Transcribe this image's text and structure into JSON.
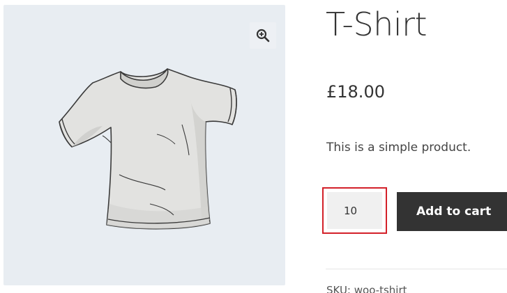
{
  "product": {
    "title": "T-Shirt",
    "price": "£18.00",
    "description": "This is a simple product.",
    "sku_label": "SKU:",
    "sku_value": "woo-tshirt"
  },
  "purchase": {
    "quantity": "10",
    "add_to_cart_label": "Add to cart"
  },
  "gallery": {
    "zoom_icon": "zoom-in-icon",
    "image_subject": "t-shirt"
  },
  "colors": {
    "gallery_background": "#e8edf2",
    "button_background": "#333333",
    "highlight_border": "#d32029"
  }
}
